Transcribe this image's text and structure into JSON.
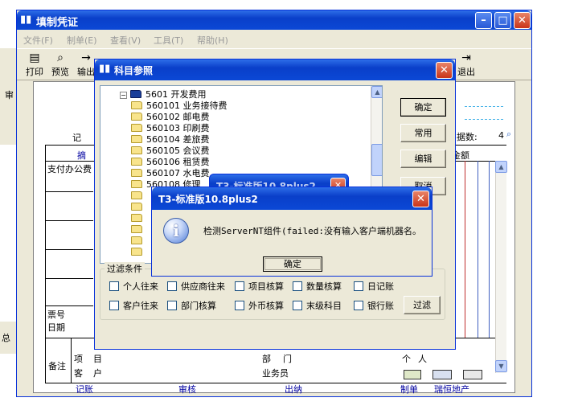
{
  "main_window": {
    "title": "填制凭证",
    "menu": [
      "文件(F)",
      "制单(E)",
      "查看(V)",
      "工具(T)",
      "帮助(H)"
    ],
    "toolbar": {
      "print": "打印",
      "preview": "预览",
      "export": "输出",
      "exit": "退出"
    }
  },
  "voucher": {
    "record_label": "记",
    "summary_header": "摘",
    "summary_row1": "支付办公费",
    "amount_header": "金额",
    "attachments_label": "据数:",
    "attachments_value": "4",
    "ticket_no": "票号",
    "date": "日期",
    "remarks": "备注",
    "item": "项",
    "item_suffix": "目",
    "customer": "客",
    "customer_suffix": "户",
    "department": "部",
    "department_suffix": "门",
    "salesperson": "业务员",
    "personal": "个",
    "personal_suffix": "人",
    "footer": {
      "bookkeeping": "记账",
      "audit": "审核",
      "cashier": "出纳",
      "prepared": "制单",
      "preparer": "瑞恒地产"
    }
  },
  "left_fragments": {
    "top": "审",
    "bottom": "总"
  },
  "ref_dialog": {
    "title": "科目参照",
    "tree": [
      {
        "code": "5601",
        "name": "开发费用",
        "kind": "root"
      },
      {
        "code": "560101",
        "name": "业务接待费"
      },
      {
        "code": "560102",
        "name": "邮电费"
      },
      {
        "code": "560103",
        "name": "印刷费"
      },
      {
        "code": "560104",
        "name": "差旅费"
      },
      {
        "code": "560105",
        "name": "会议费"
      },
      {
        "code": "560106",
        "name": "租赁费"
      },
      {
        "code": "560107",
        "name": "水电费"
      },
      {
        "code": "560108",
        "name": "修理"
      }
    ],
    "buttons": {
      "ok": "确定",
      "common": "常用",
      "edit": "编辑",
      "cancel": "取消",
      "filter": "过滤"
    },
    "filter": {
      "legend": "过滤条件",
      "row1": [
        "个人往来",
        "供应商往来",
        "项目核算",
        "数量核算",
        "日记账"
      ],
      "row2": [
        "客户往来",
        "部门核算",
        "外币核算",
        "末级科目",
        "银行账"
      ]
    }
  },
  "mini_window": {
    "title": "T3-标准版10.8plus2"
  },
  "error_dialog": {
    "title": "T3-标准版10.8plus2",
    "message": "检测ServerNT组件(failed:没有输入客户端机器名。",
    "ok": "确定"
  },
  "colors": {
    "title_bar": "#0a3fc9",
    "dialog_bg": "#ece9d8",
    "link_blue": "#0000a0"
  }
}
